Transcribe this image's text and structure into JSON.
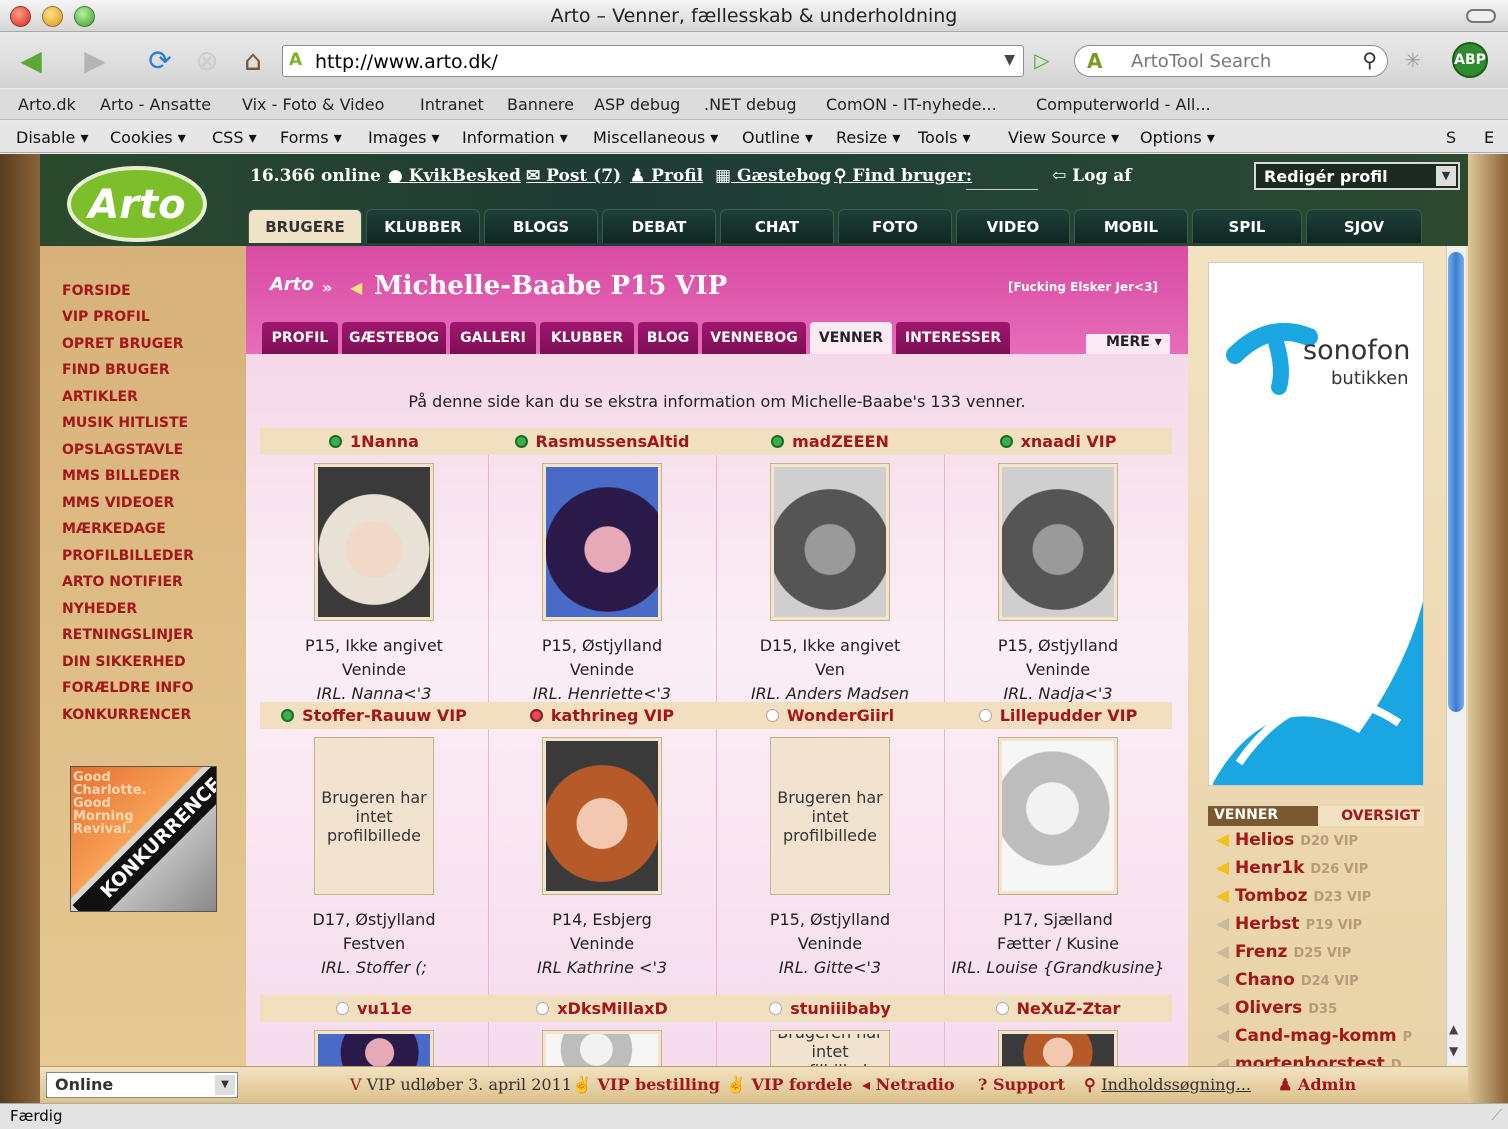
{
  "window": {
    "title": "Arto – Venner, fællesskab & underholdning"
  },
  "browser": {
    "url": "http://www.arto.dk/",
    "search_placeholder": "ArtoTool Search",
    "abp_label": "ABP",
    "bookmarks": [
      "Arto.dk",
      "Arto - Ansatte",
      "Vix - Foto & Video",
      "Intranet",
      "Bannere",
      "ASP debug",
      ".NET debug",
      "ComON - IT-nyhede...",
      "Computerworld - All..."
    ],
    "devbar": [
      "Disable ▾",
      "Cookies ▾",
      "CSS ▾",
      "Forms ▾",
      "Images ▾",
      "Information ▾",
      "Miscellaneous ▾",
      "Outline ▾",
      "Resize ▾",
      "Tools ▾",
      "View Source ▾",
      "Options ▾",
      "S",
      "E"
    ],
    "status": "Færdig"
  },
  "site": {
    "logo": "Arto",
    "online_count": "16.366 online",
    "top_links": [
      "KvikBesked",
      "Post (7)",
      "Profil",
      "Gæstebog",
      "Find bruger:",
      "Log af"
    ],
    "profile_select": "Redigér profil",
    "main_tabs": [
      "BRUGERE",
      "KLUBBER",
      "BLOGS",
      "DEBAT",
      "CHAT",
      "FOTO",
      "VIDEO",
      "MOBIL",
      "SPIL",
      "SJOV"
    ],
    "left_nav": [
      "FORSIDE",
      "VIP PROFIL",
      "OPRET BRUGER",
      "FIND BRUGER",
      "ARTIKLER",
      "MUSIK HITLISTE",
      "OPSLAGSTAVLE",
      "MMS BILLEDER",
      "MMS VIDEOER",
      "MÆRKEDAGE",
      "PROFILBILLEDER",
      "ARTO NOTIFIER",
      "NYHEDER",
      "RETNINGSLINJER",
      "DIN SIKKERHED",
      "FORÆLDRE INFO",
      "KONKURRENCER"
    ],
    "konkurrence": {
      "text": "Good Charlotte. Good Morning Revival.",
      "banner": "KONKURRENCE"
    }
  },
  "profile": {
    "logo": "Arto",
    "name": "Michelle-Baabe P15 VIP",
    "subtitle": "[Fucking Elsker Jer<3]",
    "tabs": [
      "PROFIL",
      "GÆSTEBOG",
      "GALLERI",
      "KLUBBER",
      "BLOG",
      "VENNEBOG",
      "VENNER",
      "INTERESSER"
    ],
    "more": "MERE",
    "intro": "På denne side kan du se ekstra information om Michelle-Baabe's 133 venner.",
    "no_picture": "Brugeren har intet profilbillede",
    "friends": [
      {
        "name": "1Nanna",
        "status": "green",
        "info": "P15, Ikke angivet",
        "relation": "Veninde",
        "irl": "IRL. Nanna<'3",
        "photo": "blonde"
      },
      {
        "name": "RasmussensAltid",
        "status": "green",
        "info": "P15, Østjylland",
        "relation": "Veninde",
        "irl": "IRL. Henriette<'3",
        "photo": "dark"
      },
      {
        "name": "madZEEEN",
        "status": "green",
        "info": "D15, Ikke angivet",
        "relation": "Ven",
        "irl": "IRL. Anders Madsen",
        "photo": "grey"
      },
      {
        "name": "xnaadi VIP",
        "status": "green",
        "info": "P15, Østjylland",
        "relation": "Veninde",
        "irl": "IRL. Nadja<'3",
        "photo": "grey"
      },
      {
        "name": "Stoffer-Rauuw VIP",
        "status": "green",
        "info": "D17, Østjylland",
        "relation": "Festven",
        "irl": "IRL. Stoffer (;",
        "photo": "none"
      },
      {
        "name": "kathrineg VIP",
        "status": "red",
        "info": "P14, Esbjerg",
        "relation": "Veninde",
        "irl": "IRL Kathrine <'3",
        "photo": "red"
      },
      {
        "name": "WonderGiirl",
        "status": "grey",
        "info": "P15, Østjylland",
        "relation": "Veninde",
        "irl": "IRL. Gitte<'3",
        "photo": "none"
      },
      {
        "name": "Lillepudder VIP",
        "status": "grey",
        "info": "P17, Sjælland",
        "relation": "Fætter / Kusine",
        "irl": "IRL. Louise {Grandkusine}",
        "photo": "light"
      },
      {
        "name": "vu11e",
        "status": "grey",
        "info": "",
        "relation": "",
        "irl": "",
        "photo": "dark"
      },
      {
        "name": "xDksMillaxD",
        "status": "grey",
        "info": "",
        "relation": "",
        "irl": "",
        "photo": "light"
      },
      {
        "name": "stuniiibaby",
        "status": "grey",
        "info": "",
        "relation": "",
        "irl": "",
        "photo": "none"
      },
      {
        "name": "NeXuZ-Ztar",
        "status": "grey",
        "info": "",
        "relation": "",
        "irl": "",
        "photo": "red"
      }
    ]
  },
  "sidebar": {
    "ad": {
      "brand": "sonofon",
      "sub": "butikken"
    },
    "venner_label": "VENNER",
    "oversigt_label": "OVERSIGT",
    "friends": [
      {
        "name": "Helios",
        "meta": "D20 VIP",
        "online": true
      },
      {
        "name": "Henr1k",
        "meta": "D26 VIP",
        "online": true
      },
      {
        "name": "Tomboz",
        "meta": "D23 VIP",
        "online": true
      },
      {
        "name": "Herbst",
        "meta": "P19 VIP",
        "online": false
      },
      {
        "name": "Frenz",
        "meta": "D25 VIP",
        "online": false
      },
      {
        "name": "Chano",
        "meta": "D24 VIP",
        "online": false
      },
      {
        "name": "Olivers",
        "meta": "D35",
        "online": false
      },
      {
        "name": "Cand-mag-komm",
        "meta": "P",
        "online": false
      },
      {
        "name": "mortenhorstest",
        "meta": "D",
        "online": false
      }
    ]
  },
  "bottom": {
    "status_select": "Online",
    "vip_expiry": "VIP udløber 3. april 2011",
    "links": [
      "VIP bestilling",
      "VIP fordele",
      "Netradio",
      "Support",
      "Indholdssøgning...",
      "Admin"
    ]
  },
  "colors": {
    "accent_red": "#a3171b",
    "pink": "#e05aae",
    "dark_green": "#1f3f39"
  }
}
